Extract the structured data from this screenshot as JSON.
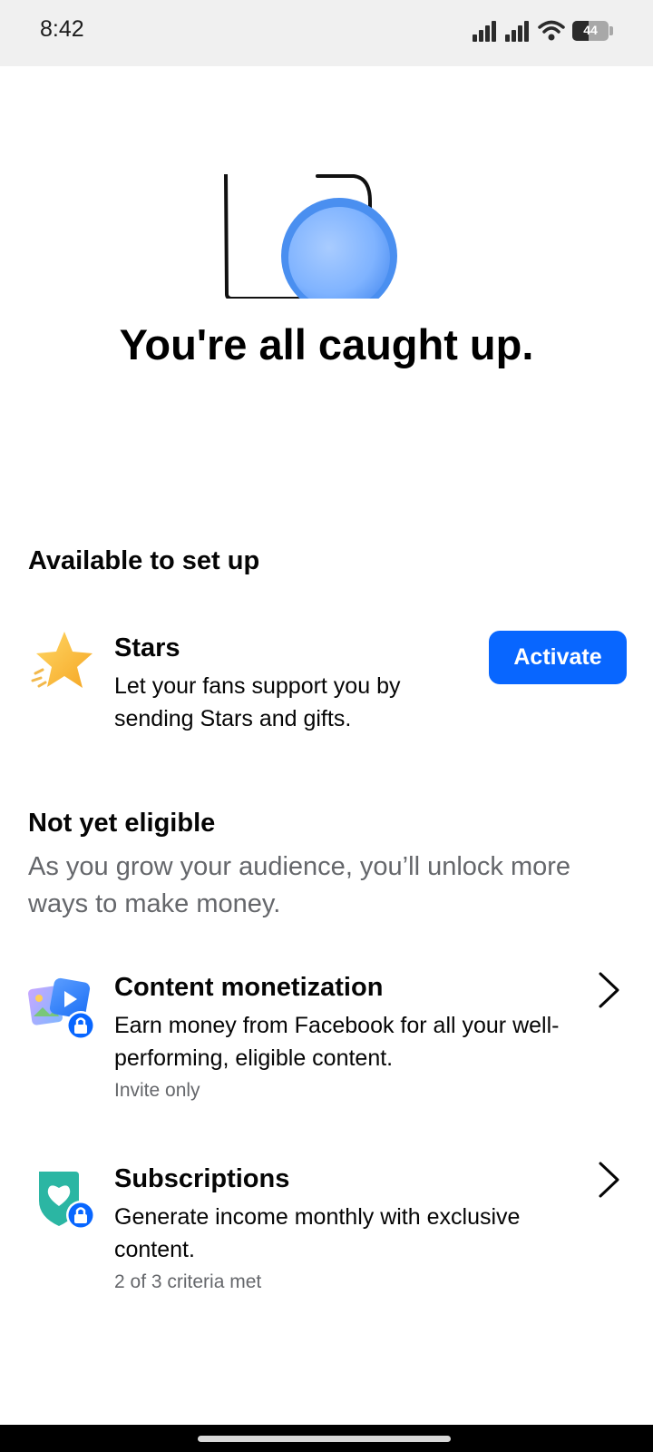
{
  "status_bar": {
    "time": "8:42",
    "battery_level": "44",
    "battery_fraction": 0.44,
    "icons": [
      "signal-icon",
      "signal-icon",
      "wifi-icon",
      "battery-icon"
    ]
  },
  "hero": {
    "title": "You're all caught up."
  },
  "available": {
    "heading": "Available to set up",
    "items": [
      {
        "icon": "star-icon",
        "title": "Stars",
        "description": "Let your fans support you by sending Stars and gifts.",
        "button_label": "Activate"
      }
    ]
  },
  "not_eligible": {
    "heading": "Not yet eligible",
    "subtitle": "As you grow your audience, you’ll unlock more ways to make money.",
    "items": [
      {
        "icon": "content-monetization-icon",
        "title": "Content monetization",
        "description": "Earn money from Facebook for all your well-performing, eligible content.",
        "meta": "Invite only"
      },
      {
        "icon": "subscriptions-heart-shield-icon",
        "title": "Subscriptions",
        "description": "Generate income monthly with exclusive content.",
        "meta": "2 of 3 criteria met"
      }
    ]
  },
  "colors": {
    "accent": "#0866ff",
    "secondary_text": "#65676b",
    "status_bar_bg": "#f0f0f0",
    "subscriptions_teal": "#2bb6a3"
  }
}
